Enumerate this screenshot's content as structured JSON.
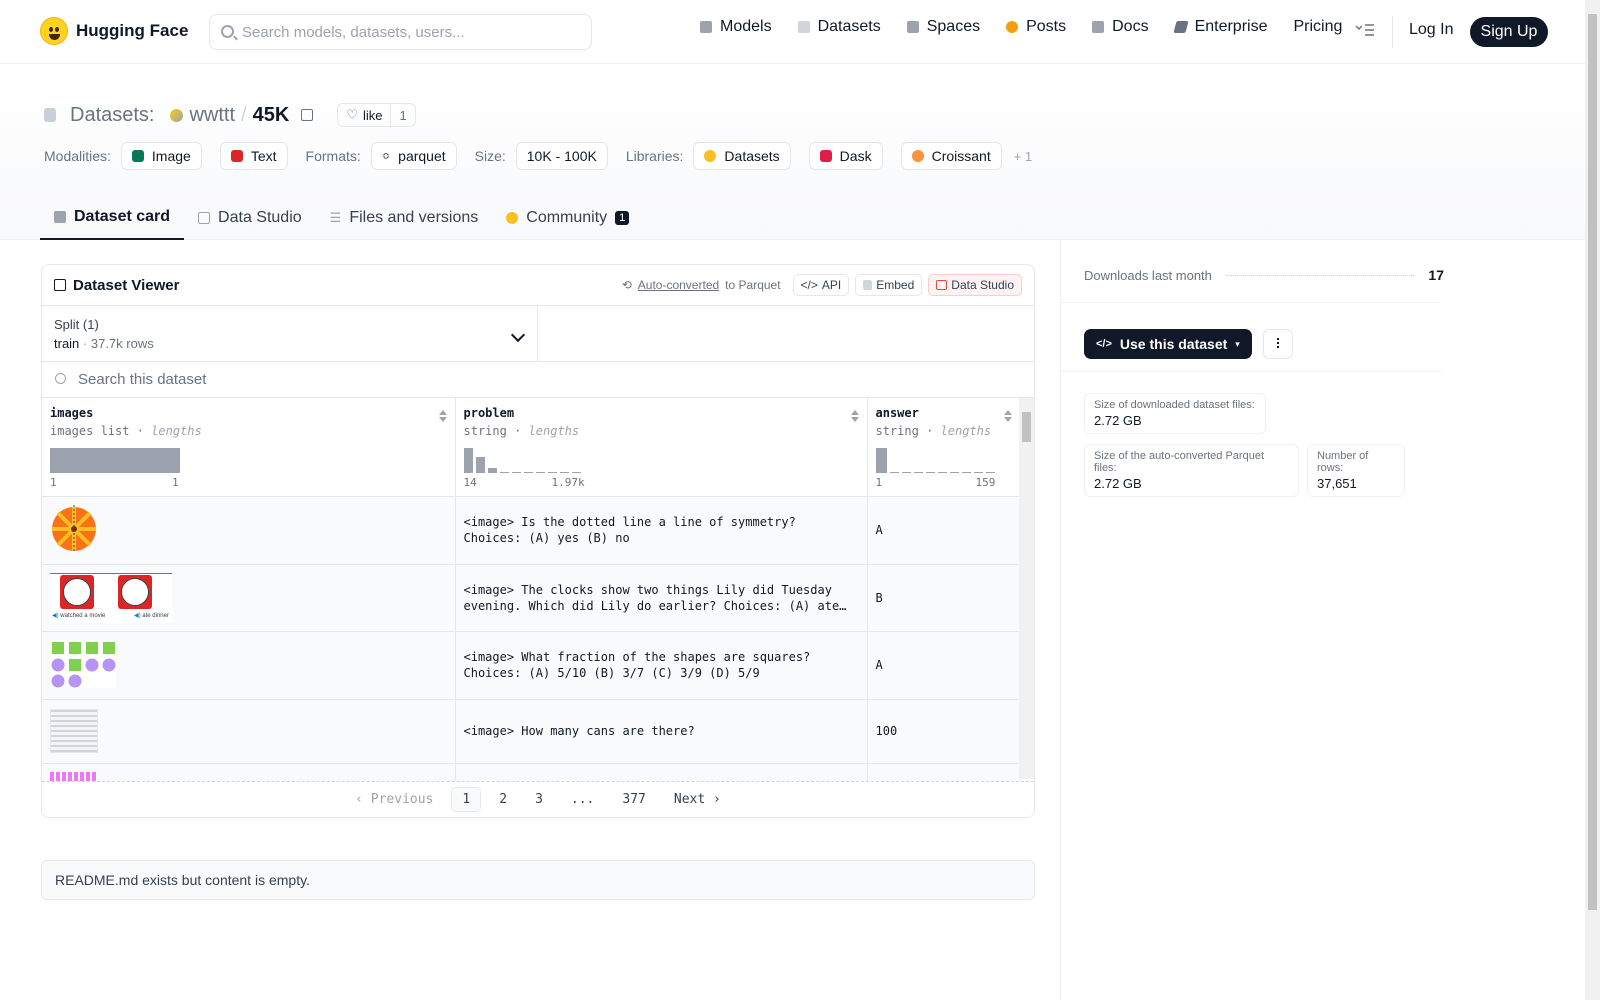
{
  "brand": {
    "name": "Hugging Face"
  },
  "search": {
    "placeholder": "Search models, datasets, users..."
  },
  "nav": {
    "items": [
      {
        "label": "Models",
        "color": "#9ca3af"
      },
      {
        "label": "Datasets",
        "color": "#d1d5db"
      },
      {
        "label": "Spaces",
        "color": "#9ca3af"
      },
      {
        "label": "Posts",
        "color": "#f59e0b"
      },
      {
        "label": "Docs",
        "color": "#9ca3af"
      },
      {
        "label": "Enterprise",
        "color": "#6b7280"
      },
      {
        "label": "Pricing",
        "color": ""
      }
    ],
    "login": "Log In",
    "signup": "Sign Up"
  },
  "header": {
    "section": "Datasets:",
    "owner": "wwttt",
    "separator": "/",
    "name": "45K",
    "like_label": "like",
    "like_count": "1"
  },
  "tags": {
    "modalities_label": "Modalities:",
    "modalities": [
      "Image",
      "Text"
    ],
    "formats_label": "Formats:",
    "formats": [
      "parquet"
    ],
    "size_label": "Size:",
    "size": "10K - 100K",
    "libraries_label": "Libraries:",
    "libraries": [
      "Datasets",
      "Dask",
      "Croissant"
    ],
    "more": "+ 1"
  },
  "tabs": [
    {
      "label": "Dataset card"
    },
    {
      "label": "Data Studio"
    },
    {
      "label": "Files and versions"
    },
    {
      "label": "Community",
      "badge": "1"
    }
  ],
  "viewer": {
    "title": "Dataset Viewer",
    "auto_converted": "Auto-converted",
    "to_parquet": "to Parquet",
    "api": "API",
    "embed": "Embed",
    "data_studio": "Data Studio",
    "split_label": "Split (1)",
    "split_name": "train",
    "split_rows": "37.7k rows",
    "search_placeholder": "Search this dataset",
    "columns": [
      {
        "name": "images",
        "type": "images list",
        "stat": "lengths",
        "min": "1",
        "max": "1"
      },
      {
        "name": "problem",
        "type": "string",
        "stat": "lengths",
        "min": "14",
        "max": "1.97k"
      },
      {
        "name": "answer",
        "type": "string",
        "stat": "lengths",
        "min": "1",
        "max": "159"
      }
    ],
    "rows": [
      {
        "problem": "<image> Is the dotted line a line of symmetry? Choices: (A) yes (B) no",
        "answer": "A"
      },
      {
        "problem": "<image> The clocks show two things Lily did Tuesday evening. Which did Lily do earlier? Choices: (A) ate…",
        "answer": "B",
        "captions": [
          "watched a movie",
          "ate dinner"
        ]
      },
      {
        "problem": "<image> What fraction of the shapes are squares? Choices: (A) 5/10 (B) 3/7 (C) 3/9 (D) 5/9",
        "answer": "A"
      },
      {
        "problem": "<image> How many cans are there?",
        "answer": "100"
      },
      {
        "problem": "",
        "answer": ""
      }
    ],
    "pager": {
      "prev": "Previous",
      "pages": [
        "1",
        "2",
        "3",
        "...",
        "377"
      ],
      "next": "Next"
    }
  },
  "readme": {
    "text": "README.md exists but content is empty."
  },
  "sidebar": {
    "downloads_label": "Downloads last month",
    "downloads_value": "17",
    "use_label": "Use this dataset",
    "download_size_label": "Size of downloaded dataset files:",
    "download_size": "2.72 GB",
    "parquet_size_label": "Size of the auto-converted Parquet files:",
    "parquet_size": "2.72 GB",
    "rows_label": "Number of rows:",
    "rows_value": "37,651"
  }
}
